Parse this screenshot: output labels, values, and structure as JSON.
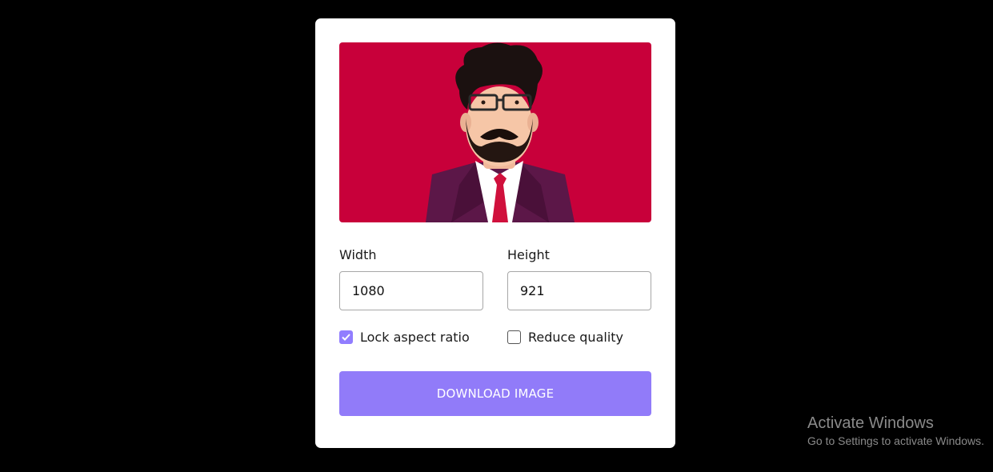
{
  "preview": {
    "background_color": "#c8003a",
    "alt": "cartoon-avatar"
  },
  "width_field": {
    "label": "Width",
    "value": "1080"
  },
  "height_field": {
    "label": "Height",
    "value": "921"
  },
  "options": {
    "lock_aspect_ratio": {
      "label": "Lock aspect ratio",
      "checked": true
    },
    "reduce_quality": {
      "label": "Reduce quality",
      "checked": false
    }
  },
  "download_button": {
    "label": "DOWNLOAD IMAGE",
    "color": "#917bf9"
  },
  "watermark": {
    "title": "Activate Windows",
    "subtitle": "Go to Settings to activate Windows."
  },
  "colors": {
    "page_background": "#000000",
    "card_background": "#ffffff",
    "accent": "#917dff"
  }
}
